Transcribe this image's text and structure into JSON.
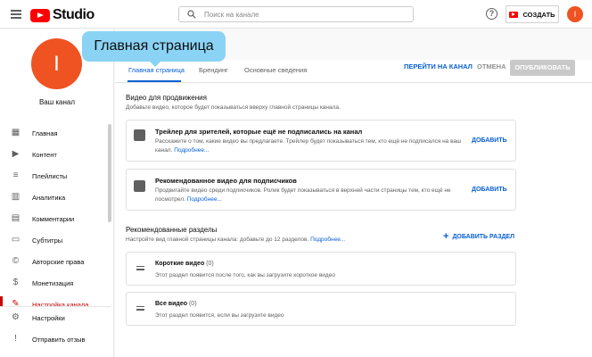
{
  "app": {
    "title": "Studio"
  },
  "search": {
    "placeholder": "Поиск на канале"
  },
  "header": {
    "create_label": "СОЗДАТЬ",
    "help_glyph": "?",
    "avatar_letter": "I"
  },
  "sidebar": {
    "avatar_letter": "I",
    "channel_label": "Ваш канал",
    "items": [
      {
        "label": "Главная",
        "icon": "dashboard-icon",
        "glyph": "▦"
      },
      {
        "label": "Контент",
        "icon": "content-icon",
        "glyph": "▶"
      },
      {
        "label": "Плейлисты",
        "icon": "playlist-icon",
        "glyph": "≡"
      },
      {
        "label": "Аналитика",
        "icon": "analytics-icon",
        "glyph": "▥"
      },
      {
        "label": "Комментарии",
        "icon": "comments-icon",
        "glyph": "▤"
      },
      {
        "label": "Субтитры",
        "icon": "subtitles-icon",
        "glyph": "▭"
      },
      {
        "label": "Авторские права",
        "icon": "copyright-icon",
        "glyph": "©"
      },
      {
        "label": "Монетизация",
        "icon": "monetization-icon",
        "glyph": "$"
      },
      {
        "label": "Настройка канала",
        "icon": "customization-icon",
        "glyph": "✎"
      }
    ],
    "bottom_items": [
      {
        "label": "Настройки",
        "icon": "gear-icon",
        "glyph": "⚙"
      },
      {
        "label": "Отправить отзыв",
        "icon": "feedback-icon",
        "glyph": "!"
      }
    ]
  },
  "tooltip": {
    "text": "Главная страница"
  },
  "tabs": [
    {
      "label": "Главная страница"
    },
    {
      "label": "Брендинг"
    },
    {
      "label": "Основные сведения"
    }
  ],
  "actions": {
    "view_channel": "ПЕРЕЙТИ НА КАНАЛ",
    "cancel": "ОТМЕНА",
    "publish": "ОПУБЛИКОВАТЬ"
  },
  "video_spotlight": {
    "title": "Видео для продвижения",
    "subtitle": "Добавьте видео, которое будет показываться вверху главной страницы канала.",
    "cards": [
      {
        "title": "Трейлер для зрителей, которые ещё не подписались на канал",
        "desc_line1": "Расскажите о том, какие видео вы предлагаете. Трейлер будет показываться тем, кто ещё не подписался на ваш",
        "desc_line2": "канал.",
        "more": "Подробнее...",
        "add": "ДОБАВИТЬ"
      },
      {
        "title": "Рекомендованное видео для подписчиков",
        "desc_line1": "Продвигайте видео среди подписчиков. Ролик будет показываться в верхней части страницы тем, кто ещё не",
        "desc_line2": "посмотрел.",
        "more": "Подробнее...",
        "add": "ДОБАВИТЬ"
      }
    ]
  },
  "featured_sections": {
    "title": "Рекомендованные разделы",
    "subtitle": "Настройте вид главной страницы канала: добавьте до 12 разделов.",
    "more": "Подробнее...",
    "add_section": "ДОБАВИТЬ РАЗДЕЛ",
    "sections": [
      {
        "title": "Короткие видео",
        "count": "(0)",
        "desc": "Этот раздел появится после того, как вы загрузите короткое видео"
      },
      {
        "title": "Все видео",
        "count": "(0)",
        "desc": "Этот раздел появится, если вы загрузите видео"
      }
    ]
  },
  "colors": {
    "brand_red": "#ff0000",
    "accent_blue": "#065fd4",
    "avatar": "#ef5322",
    "tooltip": "#8bd3f5"
  }
}
